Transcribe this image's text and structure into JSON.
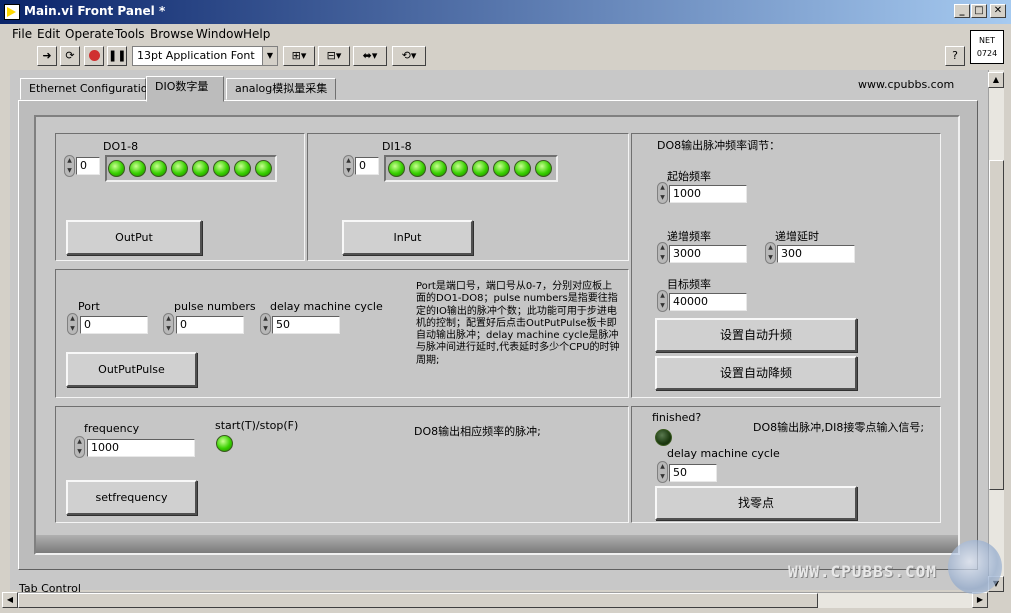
{
  "window": {
    "title": "Main.vi Front Panel *",
    "min": "_",
    "max": "□",
    "close": "✕"
  },
  "menu": [
    "File",
    "Edit",
    "Operate",
    "Tools",
    "Browse",
    "Window",
    "Help"
  ],
  "toolbar": {
    "font": "13pt Application Font",
    "help": "?",
    "net": "NET",
    "net_code": "0724"
  },
  "tabs": [
    "Ethernet Configuration",
    "DIO数字量",
    "analog模拟量采集"
  ],
  "active_tab": 1,
  "site_link": "www.cpubbs.com",
  "do_panel": {
    "label": "DO1-8",
    "value": "0",
    "leds": [
      true,
      true,
      true,
      true,
      true,
      true,
      true,
      true
    ],
    "button": "OutPut"
  },
  "di_panel": {
    "label": "DI1-8",
    "value": "0",
    "leds": [
      true,
      true,
      true,
      true,
      true,
      true,
      true,
      true
    ],
    "button": "InPut"
  },
  "pulse_panel": {
    "port_label": "Port",
    "port_value": "0",
    "pulse_label": "pulse numbers",
    "pulse_value": "0",
    "delay_label": "delay machine cycle",
    "delay_value": "50",
    "button": "OutPutPulse",
    "description": "Port是端口号，端口号从0-7，分别对应板上面的DO1-DO8；pulse numbers是指要往指定的IO输出的脉冲个数；此功能可用于步进电机的控制；配置好后点击OutPutPulse板卡即自动输出脉冲；delay machine cycle是脉冲与脉冲间进行延时,代表延时多少个CPU的时钟周期;"
  },
  "freq_panel": {
    "freq_label": "frequency",
    "freq_value": "1000",
    "toggle_label": "start(T)/stop(F)",
    "button": "setfrequency",
    "description": "DO8输出相应频率的脉冲;"
  },
  "ramp_panel": {
    "title": "DO8输出脉冲频率调节：",
    "start_label": "起始频率",
    "start_value": "1000",
    "inc_label": "递增频率",
    "inc_value": "3000",
    "delay_label": "递增延时",
    "delay_value": "300",
    "target_label": "目标频率",
    "target_value": "40000",
    "up_button": "设置自动升频",
    "down_button": "设置自动降频"
  },
  "zero_panel": {
    "finished_label": "finished?",
    "description": "DO8输出脉冲,DI8接零点输入信号;",
    "delay_label": "delay machine cycle",
    "delay_value": "50",
    "button": "找零点"
  },
  "status_label": "Tab Control",
  "watermark": "WWW.CPUBBS.COM"
}
